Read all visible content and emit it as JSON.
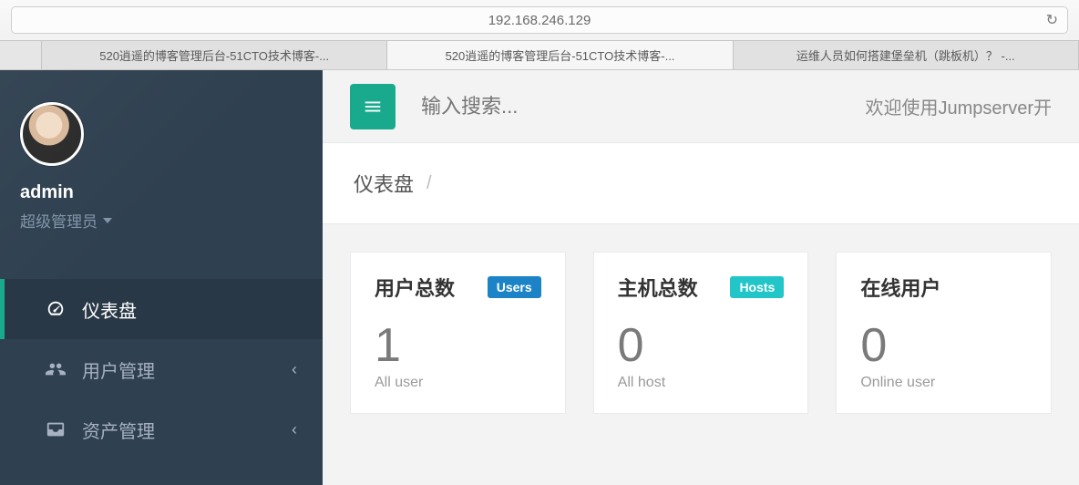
{
  "browser": {
    "url": "192.168.246.129",
    "tabs": [
      "",
      "520逍遥的博客管理后台-51CTO技术博客-...",
      "520逍遥的博客管理后台-51CTO技术博客-...",
      "运维人员如何搭建堡垒机（跳板机）？ -..."
    ]
  },
  "user": {
    "name": "admin",
    "role": "超级管理员"
  },
  "nav": [
    {
      "label": "仪表盘",
      "active": true,
      "has_children": false
    },
    {
      "label": "用户管理",
      "active": false,
      "has_children": true
    },
    {
      "label": "资产管理",
      "active": false,
      "has_children": true
    }
  ],
  "topbar": {
    "search_placeholder": "输入搜索...",
    "welcome": "欢迎使用Jumpserver开"
  },
  "breadcrumb": {
    "title": "仪表盘",
    "sep": "/"
  },
  "cards": [
    {
      "title": "用户总数",
      "badge": "Users",
      "badge_class": "badge-users",
      "value": "1",
      "sub": "All user"
    },
    {
      "title": "主机总数",
      "badge": "Hosts",
      "badge_class": "badge-hosts",
      "value": "0",
      "sub": "All host"
    },
    {
      "title": "在线用户",
      "badge": "",
      "badge_class": "",
      "value": "0",
      "sub": "Online user"
    }
  ]
}
